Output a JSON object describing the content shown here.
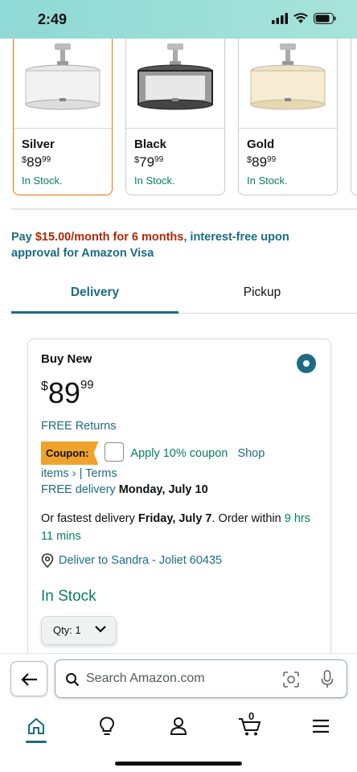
{
  "status": {
    "time": "2:49"
  },
  "variants": [
    {
      "name": "Silver",
      "currency": "$",
      "price_whole": "89",
      "price_cents": "99",
      "stock": "In Stock.",
      "selected": true,
      "shade": "silver"
    },
    {
      "name": "Black",
      "currency": "$",
      "price_whole": "79",
      "price_cents": "99",
      "stock": "In Stock.",
      "selected": false,
      "shade": "black"
    },
    {
      "name": "Gold",
      "currency": "$",
      "price_whole": "89",
      "price_cents": "99",
      "stock": "In Stock.",
      "selected": false,
      "shade": "gold"
    }
  ],
  "promo": {
    "prefix": "Pay ",
    "amount": "$15.00/month for 6 months",
    "suffix": ", interest-free upon approval for Amazon Visa"
  },
  "tabs": {
    "delivery": "Delivery",
    "pickup": "Pickup"
  },
  "buy_box": {
    "title": "Buy New",
    "currency": "$",
    "price_whole": "89",
    "price_cents": "99",
    "free_returns": "FREE Returns",
    "coupon_badge": "Coupon:",
    "coupon_text": "Apply 10% coupon",
    "shop_link": "Shop",
    "items_link": "items",
    "items_chevron": "›",
    "separator": "|",
    "terms_link": "Terms",
    "free_delivery_prefix": "FREE delivery",
    "free_delivery_date": "Monday, July 10",
    "fastest_prefix": "Or fastest delivery",
    "fastest_date": "Friday, July 7",
    "order_within_text": ". Order within",
    "order_within_time": "9 hrs 11 mins",
    "deliver_to": "Deliver to Sandra - Joliet 60435",
    "in_stock": "In Stock",
    "qty_label": "Qty: 1"
  },
  "search": {
    "placeholder": "Search Amazon.com"
  },
  "nav": {
    "cart_count": "0"
  },
  "colors": {
    "teal": "#1c6b83",
    "green": "#067d62",
    "price_red": "#b12704",
    "coupon_orange": "#f0a32c",
    "selected_orange": "#e77600"
  }
}
